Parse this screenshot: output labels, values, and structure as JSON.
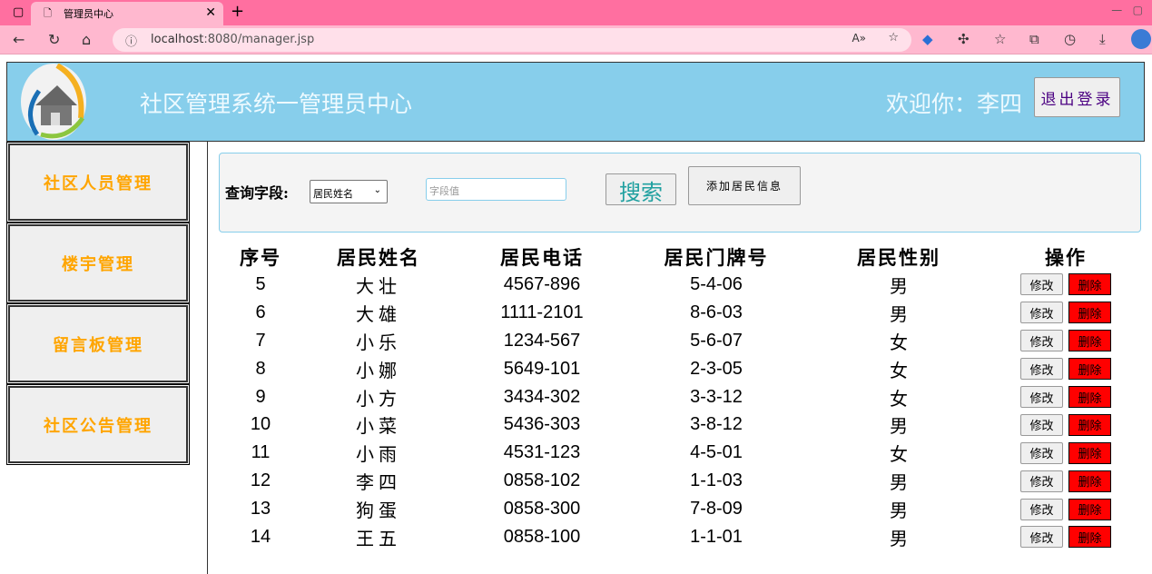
{
  "browser": {
    "tab_title": "管理员中心",
    "url_host": "localhost",
    "url_path": ":8080/manager.jsp"
  },
  "header": {
    "title": "社区管理系统一管理员中心",
    "welcome": "欢迎你：李四",
    "logout": "退出登录"
  },
  "sidebar": {
    "items": [
      {
        "label": "社区人员管理"
      },
      {
        "label": "楼宇管理"
      },
      {
        "label": "留言板管理"
      },
      {
        "label": "社区公告管理"
      }
    ]
  },
  "search": {
    "field_label": "查询字段:",
    "field_selected": "居民姓名",
    "value_placeholder": "字段值",
    "search_button": "搜索",
    "add_button": "添加居民信息"
  },
  "table": {
    "headers": [
      "序号",
      "居民姓名",
      "居民电话",
      "居民门牌号",
      "居民性别",
      "操作"
    ],
    "edit_label": "修改",
    "delete_label": "删除",
    "rows": [
      [
        "5",
        "大壮",
        "4567-896",
        "5-4-06",
        "男"
      ],
      [
        "6",
        "大雄",
        "1111-2101",
        "8-6-03",
        "男"
      ],
      [
        "7",
        "小乐",
        "1234-567",
        "5-6-07",
        "女"
      ],
      [
        "8",
        "小娜",
        "5649-101",
        "2-3-05",
        "女"
      ],
      [
        "9",
        "小方",
        "3434-302",
        "3-3-12",
        "女"
      ],
      [
        "10",
        "小菜",
        "5436-303",
        "3-8-12",
        "男"
      ],
      [
        "11",
        "小雨",
        "4531-123",
        "4-5-01",
        "女"
      ],
      [
        "12",
        "李四",
        "0858-102",
        "1-1-03",
        "男"
      ],
      [
        "13",
        "狗蛋",
        "0858-300",
        "7-8-09",
        "男"
      ],
      [
        "14",
        "王五",
        "0858-100",
        "1-1-01",
        "男"
      ]
    ]
  }
}
